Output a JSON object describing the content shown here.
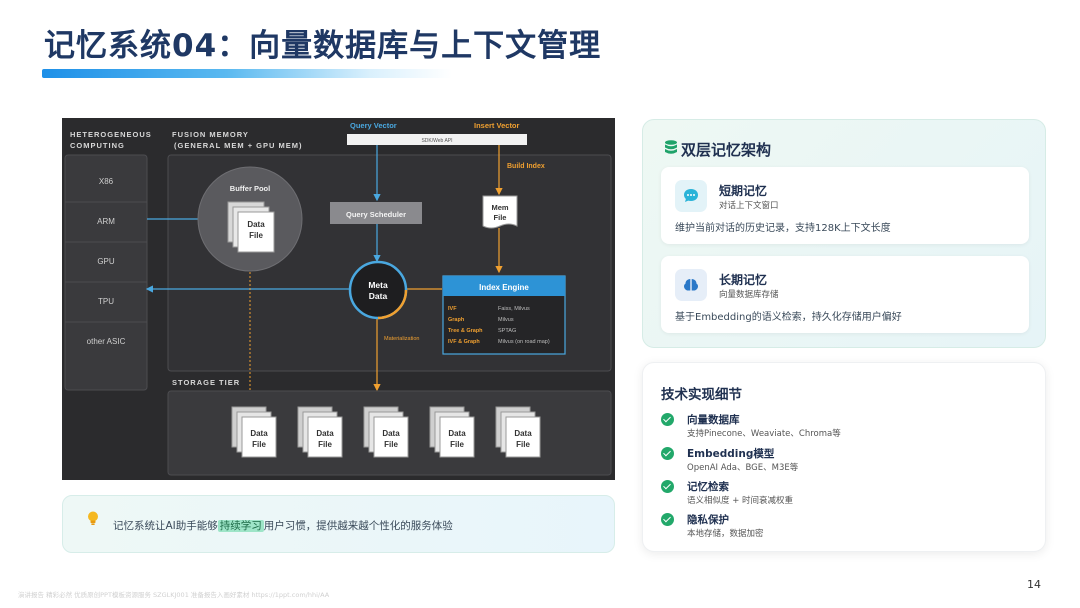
{
  "title": "记忆系统04：向量数据库与上下文管理",
  "diagram": {
    "left_heading_1": "HETEROGENEOUS",
    "left_heading_2": "COMPUTING",
    "mid_heading_1": "FUSION MEMORY",
    "mid_heading_2": "(GENERAL MEM + GPU MEM)",
    "computing_items": [
      "X86",
      "ARM",
      "GPU",
      "TPU",
      "other ASIC"
    ],
    "query_vector": "Query Vector",
    "insert_vector": "Insert Vector",
    "sdk_api": "SDK/Web API",
    "build_index": "Build Index",
    "buffer_pool": "Buffer Pool",
    "data_file_1": "Data",
    "data_file_2": "File",
    "query_scheduler": "Query Scheduler",
    "mem_file_1": "Mem",
    "mem_file_2": "File",
    "meta_1": "Meta",
    "meta_2": "Data",
    "index_engine": "Index Engine",
    "index_rows": [
      {
        "k": "IVF",
        "v": "Faiss, Milvus"
      },
      {
        "k": "Graph",
        "v": "Milvus"
      },
      {
        "k": "Tree & Graph",
        "v": "SPTAG"
      },
      {
        "k": "IVF & Graph",
        "v": "Milvus (on road map)"
      }
    ],
    "materialization": "Materialization",
    "storage_tier": "STORAGE TIER"
  },
  "tip": {
    "prefix": "记忆系统让AI助手能够",
    "highlight": "持续学习",
    "suffix": "用户习惯，提供越来越个性化的服务体验"
  },
  "memory_panel": {
    "title": "双层记忆架构",
    "short": {
      "title": "短期记忆",
      "sub": "对话上下文窗口",
      "desc": "维护当前对话的历史记录，支持128K上下文长度"
    },
    "long": {
      "title": "长期记忆",
      "sub": "向量数据库存储",
      "desc": "基于Embedding的语义检索，持久化存储用户偏好"
    }
  },
  "tech_panel": {
    "title": "技术实现细节",
    "items": [
      {
        "name": "向量数据库",
        "desc": "支持Pinecone、Weaviate、Chroma等"
      },
      {
        "name": "Embedding模型",
        "desc": "OpenAI Ada、BGE、M3E等"
      },
      {
        "name": "记忆检索",
        "desc": "语义相似度 + 时间衰减权重"
      },
      {
        "name": "隐私保护",
        "desc": "本地存储，数据加密"
      }
    ]
  },
  "page_number": "14",
  "footer": "演讲报告  精彩必然  优质原创PPT模板资源服务  SZGLKJ001  准备报告入画好素材  https://1ppt.com/hhi/AA"
}
